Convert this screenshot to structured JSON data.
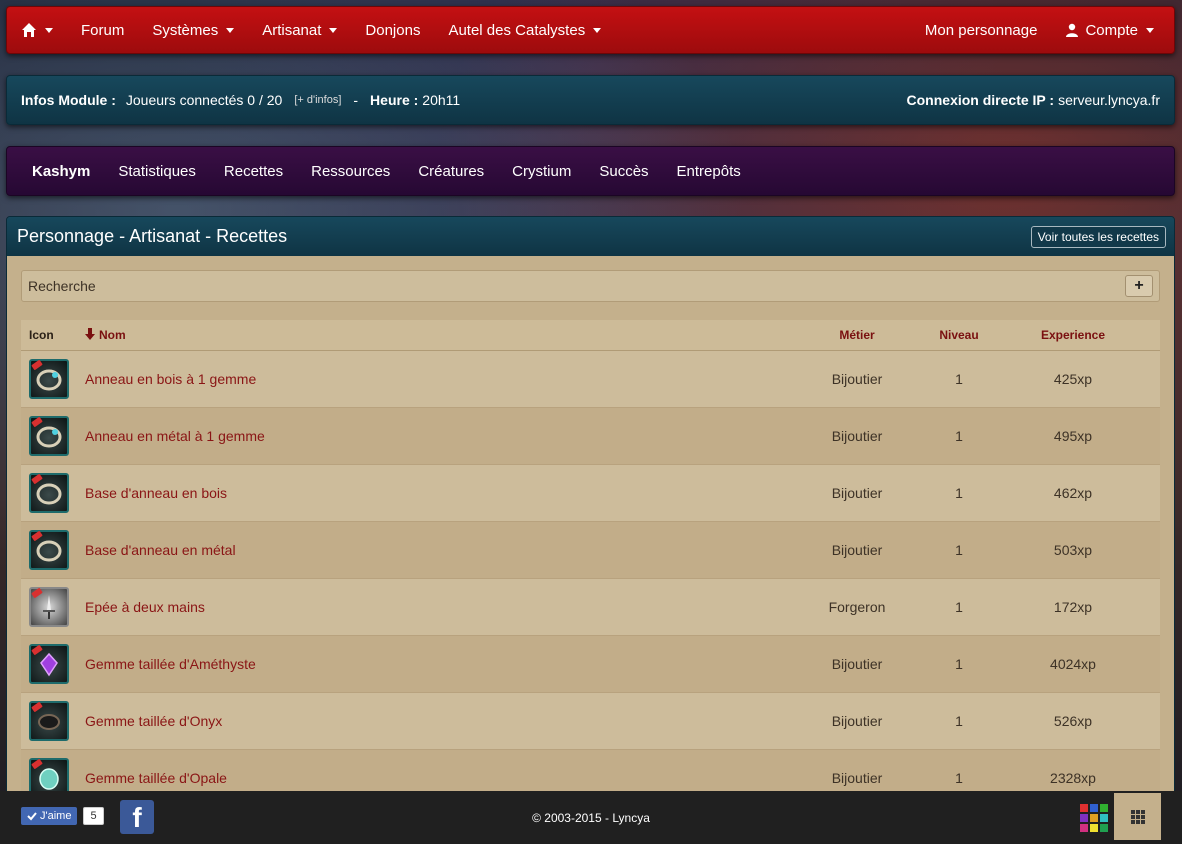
{
  "topnav": {
    "home_icon": "home-icon",
    "items": [
      {
        "label": "Forum",
        "caret": false
      },
      {
        "label": "Systèmes",
        "caret": true
      },
      {
        "label": "Artisanat",
        "caret": true
      },
      {
        "label": "Donjons",
        "caret": false
      },
      {
        "label": "Autel des Catalystes",
        "caret": true
      }
    ],
    "right": {
      "character": "Mon personnage",
      "account": "Compte",
      "account_icon": "user-icon"
    }
  },
  "infobar": {
    "module_label": "Infos Module :",
    "players": "Joueurs connectés 0 / 20",
    "more_info": "[+ d'infos]",
    "separator": "-",
    "time_label": "Heure :",
    "time": "20h11",
    "ip_label": "Connexion directe IP :",
    "ip": "serveur.lyncya.fr"
  },
  "subnav": {
    "items": [
      "Kashym",
      "Statistiques",
      "Recettes",
      "Ressources",
      "Créatures",
      "Crystium",
      "Succès",
      "Entrepôts"
    ],
    "active": "Kashym"
  },
  "panel": {
    "title": "Personnage - Artisanat - Recettes",
    "view_all": "Voir toutes les recettes",
    "search_label": "Recherche",
    "plus_label": "+",
    "columns": {
      "icon": "Icon",
      "name": "Nom",
      "job": "Métier",
      "level": "Niveau",
      "experience": "Experience"
    },
    "rows": [
      {
        "icon": "ring-gem-icon",
        "name": "Anneau en bois à 1 gemme",
        "job": "Bijoutier",
        "level": "1",
        "xp": "425xp"
      },
      {
        "icon": "ring-gem-icon",
        "name": "Anneau en métal à 1 gemme",
        "job": "Bijoutier",
        "level": "1",
        "xp": "495xp"
      },
      {
        "icon": "ring-icon",
        "name": "Base d'anneau en bois",
        "job": "Bijoutier",
        "level": "1",
        "xp": "462xp"
      },
      {
        "icon": "ring-icon",
        "name": "Base d'anneau en métal",
        "job": "Bijoutier",
        "level": "1",
        "xp": "503xp"
      },
      {
        "icon": "sword-icon",
        "name": "Epée à deux mains",
        "job": "Forgeron",
        "level": "1",
        "xp": "172xp"
      },
      {
        "icon": "amethyst-gem-icon",
        "name": "Gemme taillée d'Améthyste",
        "job": "Bijoutier",
        "level": "1",
        "xp": "4024xp"
      },
      {
        "icon": "onyx-gem-icon",
        "name": "Gemme taillée d'Onyx",
        "job": "Bijoutier",
        "level": "1",
        "xp": "526xp"
      },
      {
        "icon": "opal-gem-icon",
        "name": "Gemme taillée d'Opale",
        "job": "Bijoutier",
        "level": "1",
        "xp": "2328xp"
      }
    ]
  },
  "footer": {
    "like_label": "J'aime",
    "like_count": "5",
    "copyright": "© 2003-2015 - Lyncya",
    "facebook_icon": "facebook-icon",
    "colors": [
      "#e03030",
      "#3060d0",
      "#30b030",
      "#8030c0",
      "#e0a020",
      "#30c0c0",
      "#d03080",
      "#f0e030",
      "#20a050"
    ]
  }
}
